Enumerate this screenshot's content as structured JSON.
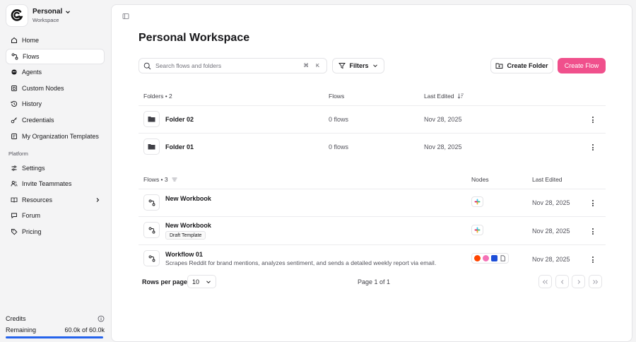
{
  "workspace": {
    "name": "Personal",
    "sub": "Workspace"
  },
  "nav": {
    "items": [
      {
        "label": "Home",
        "icon": "home-icon"
      },
      {
        "label": "Flows",
        "icon": "flow-icon",
        "active": true
      },
      {
        "label": "Agents",
        "icon": "agent-icon"
      },
      {
        "label": "Custom Nodes",
        "icon": "custom-nodes-icon"
      },
      {
        "label": "History",
        "icon": "history-icon"
      },
      {
        "label": "Credentials",
        "icon": "key-icon"
      },
      {
        "label": "My Organization Templates",
        "icon": "template-icon"
      }
    ],
    "section": "Platform",
    "platform_items": [
      {
        "label": "Settings",
        "icon": "settings-icon"
      },
      {
        "label": "Invite Teammates",
        "icon": "users-icon"
      },
      {
        "label": "Resources",
        "icon": "book-icon"
      },
      {
        "label": "Forum",
        "icon": "forum-icon"
      },
      {
        "label": "Pricing",
        "icon": "tag-icon"
      }
    ]
  },
  "credits": {
    "label": "Credits",
    "remaining_label": "Remaining",
    "remaining_value": "60.0k of 60.0k",
    "remaining_fraction": 1.0
  },
  "main": {
    "title": "Personal Workspace",
    "search_placeholder": "Search flows and folders",
    "search_shortcut": "⌘ K",
    "filters_label": "Filters",
    "create_folder_label": "Create Folder",
    "create_flow_label": "Create Flow"
  },
  "folders": {
    "header": "Folders • 2",
    "col_flows": "Flows",
    "col_last_edited": "Last Edited",
    "rows": [
      {
        "name": "Folder 02",
        "flows": "0 flows",
        "edited": "Nov 28, 2025"
      },
      {
        "name": "Folder 01",
        "flows": "0 flows",
        "edited": "Nov 28, 2025"
      }
    ]
  },
  "flows": {
    "header": "Flows • 3",
    "col_nodes": "Nodes",
    "col_last_edited": "Last Edited",
    "rows": [
      {
        "name": "New Workbook",
        "edited": "Nov 28, 2025",
        "nodes": [
          "slack"
        ]
      },
      {
        "name": "New Workbook",
        "badge": "Draft Template",
        "edited": "Nov 28, 2025",
        "nodes": [
          "slack"
        ]
      },
      {
        "name": "Workflow 01",
        "description": "Scrapes Reddit for brand mentions, analyzes sentiment, and sends a detailed weekly report via email.",
        "edited": "Nov 28, 2025",
        "nodes": [
          "reddit",
          "ai",
          "email",
          "document"
        ]
      }
    ]
  },
  "pagination": {
    "rows_per_page_label": "Rows per page",
    "rows_per_page_value": "10",
    "page_text": "Page 1 of 1"
  },
  "colors": {
    "accent": "#f0508c",
    "credit_bar": "#2563eb"
  }
}
